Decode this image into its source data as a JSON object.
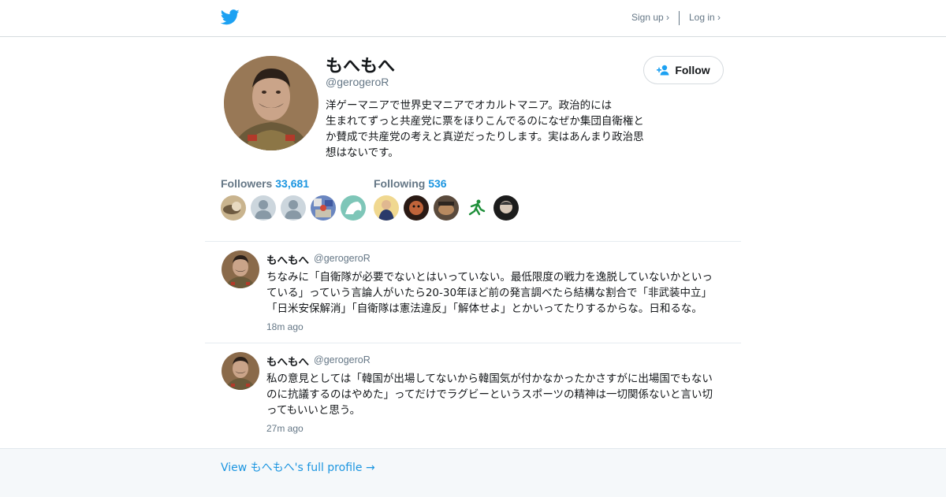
{
  "header": {
    "logo_icon": "twitter-bird-icon",
    "sign_up": "Sign up ›",
    "log_in": "Log in ›",
    "brand_color": "#1da1f2"
  },
  "profile": {
    "name": "もへもへ",
    "handle": "@gerogeroR",
    "bio": "洋ゲーマニアで世界史マニアでオカルトマニア。政治的には\n生まれてずっと共産党に票をほりこんでるのになぜか集団自衛権と\nか賛成で共産党の考えと真逆だったりします。実はあんまり政治思\n想はないです。",
    "follow_label": "Follow"
  },
  "stats": {
    "followers_label": "Followers",
    "followers_count": "33,681",
    "following_label": "Following",
    "following_count": "536"
  },
  "tweets": [
    {
      "name": "もへもへ",
      "handle": "@gerogeroR",
      "text": "ちなみに「自衛隊が必要でないとはいっていない。最低限度の戦力を逸脱していないかといっ\nている」っていう言論人がいたら20-30年ほど前の発言調べたら結構な割合で「非武装中立」\n「日米安保解消」「自衛隊は憲法違反」「解体せよ」とかいってたりするからな。日和るな。",
      "time": "18m ago"
    },
    {
      "name": "もへもへ",
      "handle": "@gerogeroR",
      "text": "私の意見としては「韓国が出場してないから韓国気が付かなかったかさすがに出場国でもない\nのに抗議するのはやめた」ってだけでラグビーというスポーツの精神は一切関係ないと言い切\nってもいいと思う。",
      "time": "27m ago"
    }
  ],
  "footer": {
    "link": "View もへもへ's full profile →"
  }
}
